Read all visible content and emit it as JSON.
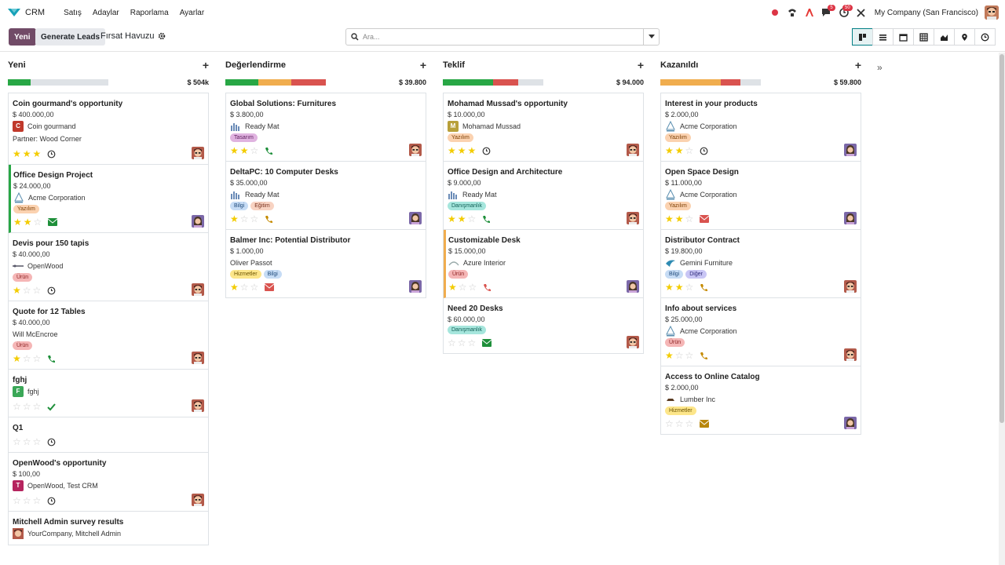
{
  "app": {
    "name": "CRM",
    "menu": [
      "Satış",
      "Adaylar",
      "Raporlama",
      "Ayarlar"
    ],
    "company": "My Company (San Francisco)",
    "badges": {
      "chat": "5",
      "activity": "50"
    }
  },
  "control": {
    "new_label": "Yeni",
    "generate_label": "Generate Leads",
    "breadcrumb": "Fırsat Havuzu",
    "search_placeholder": "Ara..."
  },
  "views": [
    "kanban-icon",
    "list-icon",
    "calendar-icon",
    "pivot-icon",
    "graph-icon",
    "map-icon",
    "activity-icon"
  ],
  "colors": {
    "accent": "#714b67",
    "primary": "#017e84",
    "green": "#28a745",
    "orange": "#f0ad4e",
    "red": "#d9534f",
    "star": "#f3cc00"
  },
  "columns": [
    {
      "title": "Yeni",
      "total": "$ 504k",
      "progress": [
        {
          "color": "#28a745",
          "frac": 0.23
        },
        {
          "color": "#dee2e6",
          "frac": 0.77
        }
      ],
      "cards": [
        {
          "title": "Coin gourmand's opportunity",
          "amount": "$ 400.000,00",
          "company": "Coin gourmand",
          "logo": {
            "letter": "C",
            "color": "#c0392b"
          },
          "extra": "Partner: Wood Corner",
          "tags": [],
          "stars": 3,
          "activity": "clock",
          "owner": "man"
        },
        {
          "title": "Office Design Project",
          "amount": "$ 24.000,00",
          "company": "Acme Corporation",
          "logo": {
            "letter": "acme",
            "color": ""
          },
          "tags": [
            {
              "label": "Yazılım",
              "bg": "#fbd2b0",
              "fg": "#7a3c00"
            }
          ],
          "stars": 2,
          "activity": "email-green",
          "owner": "woman",
          "accent": "green"
        },
        {
          "title": "Devis pour 150 tapis",
          "amount": "$ 40.000,00",
          "company": "OpenWood",
          "logo": {
            "letter": "ow",
            "color": ""
          },
          "tags": [
            {
              "label": "Ürün",
              "bg": "#f5b6b6",
              "fg": "#8a1f1f"
            }
          ],
          "stars": 1,
          "activity": "clock",
          "owner": "man"
        },
        {
          "title": "Quote for 12 Tables",
          "amount": "$ 40.000,00",
          "company": "Will McEncroe",
          "logo": null,
          "tags": [
            {
              "label": "Ürün",
              "bg": "#f5b6b6",
              "fg": "#8a1f1f"
            }
          ],
          "stars": 1,
          "activity": "phone-green",
          "owner": "man"
        },
        {
          "title": "fghj",
          "amount": "",
          "company": "fghj",
          "logo": {
            "letter": "F",
            "color": "#3aa757"
          },
          "tags": [],
          "stars": 0,
          "activity": "check",
          "owner": "man"
        },
        {
          "title": "Q1",
          "amount": "",
          "company": "",
          "logo": null,
          "tags": [],
          "stars": 0,
          "activity": "clock",
          "owner": ""
        },
        {
          "title": "OpenWood's opportunity",
          "amount": "$ 100,00",
          "company": "OpenWood, Test CRM",
          "logo": {
            "letter": "T",
            "color": "#b5245e"
          },
          "tags": [],
          "stars": 0,
          "activity": "clock",
          "owner": "man"
        },
        {
          "title": "Mitchell Admin survey results",
          "amount": "",
          "company": "YourCompany, Mitchell Admin",
          "logo": {
            "letter": "av",
            "color": ""
          },
          "tags": [],
          "stars": -1,
          "activity": "",
          "owner": ""
        }
      ]
    },
    {
      "title": "Değerlendirme",
      "total": "$ 39.800",
      "progress": [
        {
          "color": "#28a745",
          "frac": 0.33
        },
        {
          "color": "#f0ad4e",
          "frac": 0.33
        },
        {
          "color": "#d9534f",
          "frac": 0.34
        }
      ],
      "cards": [
        {
          "title": "Global Solutions: Furnitures",
          "amount": "$ 3.800,00",
          "company": "Ready Mat",
          "logo": {
            "letter": "rm",
            "color": ""
          },
          "tags": [
            {
              "label": "Tasarım",
              "bg": "#e0b3e0",
              "fg": "#5e1f5e"
            }
          ],
          "stars": 2,
          "activity": "phone-green",
          "owner": "man"
        },
        {
          "title": "DeltaPC: 10 Computer Desks",
          "amount": "$ 35.000,00",
          "company": "Ready Mat",
          "logo": {
            "letter": "rm",
            "color": ""
          },
          "tags": [
            {
              "label": "Bilgi",
              "bg": "#c6dcf5",
              "fg": "#1f4a7a"
            },
            {
              "label": "Eğitim",
              "bg": "#f8d3c2",
              "fg": "#7a3320"
            }
          ],
          "stars": 1,
          "activity": "phone-orange",
          "owner": "woman"
        },
        {
          "title": "Balmer Inc: Potential Distributor",
          "amount": "$ 1.000,00",
          "company": "Oliver Passot",
          "logo": null,
          "tags": [
            {
              "label": "Hizmetler",
              "bg": "#fde68a",
              "fg": "#6b5200"
            },
            {
              "label": "Bilgi",
              "bg": "#c6dcf5",
              "fg": "#1f4a7a"
            }
          ],
          "stars": 1,
          "activity": "email-red",
          "owner": "woman"
        }
      ]
    },
    {
      "title": "Teklif",
      "total": "$ 94.000",
      "progress": [
        {
          "color": "#28a745",
          "frac": 0.5
        },
        {
          "color": "#d9534f",
          "frac": 0.25
        },
        {
          "color": "#dee2e6",
          "frac": 0.25
        }
      ],
      "cards": [
        {
          "title": "Mohamad Mussad's opportunity",
          "amount": "$ 10.000,00",
          "company": "Mohamad Mussad",
          "logo": {
            "letter": "M",
            "color": "#b8a03a"
          },
          "tags": [
            {
              "label": "Yazılım",
              "bg": "#fbd2b0",
              "fg": "#7a3c00"
            }
          ],
          "stars": 3,
          "activity": "clock",
          "owner": "man"
        },
        {
          "title": "Office Design and Architecture",
          "amount": "$ 9.000,00",
          "company": "Ready Mat",
          "logo": {
            "letter": "rm",
            "color": ""
          },
          "tags": [
            {
              "label": "Danışmanlık",
              "bg": "#a6e6dd",
              "fg": "#0f5e54"
            }
          ],
          "stars": 2,
          "activity": "phone-green",
          "owner": "man"
        },
        {
          "title": "Customizable Desk",
          "amount": "$ 15.000,00",
          "company": "Azure Interior",
          "logo": {
            "letter": "az",
            "color": ""
          },
          "tags": [
            {
              "label": "Ürün",
              "bg": "#f5b6b6",
              "fg": "#8a1f1f"
            }
          ],
          "stars": 1,
          "activity": "phone-red",
          "owner": "woman",
          "accent": "orange"
        },
        {
          "title": "Need 20 Desks",
          "amount": "$ 60.000,00",
          "company": "",
          "logo": null,
          "tags": [
            {
              "label": "Danışmanlık",
              "bg": "#a6e6dd",
              "fg": "#0f5e54"
            }
          ],
          "stars": 0,
          "activity": "email-green",
          "owner": "man"
        }
      ]
    },
    {
      "title": "Kazanıldı",
      "total": "$ 59.800",
      "progress": [
        {
          "color": "#f0ad4e",
          "frac": 0.6
        },
        {
          "color": "#d9534f",
          "frac": 0.2
        },
        {
          "color": "#dee2e6",
          "frac": 0.2
        }
      ],
      "cards": [
        {
          "title": "Interest in your products",
          "amount": "$ 2.000,00",
          "company": "Acme Corporation",
          "logo": {
            "letter": "acme",
            "color": ""
          },
          "tags": [
            {
              "label": "Yazılım",
              "bg": "#fbd2b0",
              "fg": "#7a3c00"
            }
          ],
          "stars": 2,
          "activity": "clock",
          "owner": "woman"
        },
        {
          "title": "Open Space Design",
          "amount": "$ 11.000,00",
          "company": "Acme Corporation",
          "logo": {
            "letter": "acme",
            "color": ""
          },
          "tags": [
            {
              "label": "Yazılım",
              "bg": "#fbd2b0",
              "fg": "#7a3c00"
            }
          ],
          "stars": 2,
          "activity": "email-red",
          "owner": "woman"
        },
        {
          "title": "Distributor Contract",
          "amount": "$ 19.800,00",
          "company": "Gemini Furniture",
          "logo": {
            "letter": "gf",
            "color": ""
          },
          "tags": [
            {
              "label": "Bilgi",
              "bg": "#c6dcf5",
              "fg": "#1f4a7a"
            },
            {
              "label": "Diğer",
              "bg": "#c9c6f5",
              "fg": "#2e2a7a"
            }
          ],
          "stars": 2,
          "activity": "phone-orange",
          "owner": "man"
        },
        {
          "title": "Info about services",
          "amount": "$ 25.000,00",
          "company": "Acme Corporation",
          "logo": {
            "letter": "acme",
            "color": ""
          },
          "tags": [
            {
              "label": "Ürün",
              "bg": "#f5b6b6",
              "fg": "#8a1f1f"
            }
          ],
          "stars": 1,
          "activity": "phone-orange",
          "owner": "man"
        },
        {
          "title": "Access to Online Catalog",
          "amount": "$ 2.000,00",
          "company": "Lumber Inc",
          "logo": {
            "letter": "li",
            "color": ""
          },
          "tags": [
            {
              "label": "Hizmetler",
              "bg": "#fde68a",
              "fg": "#6b5200"
            }
          ],
          "stars": 0,
          "activity": "email-orange",
          "owner": "woman"
        }
      ]
    }
  ]
}
